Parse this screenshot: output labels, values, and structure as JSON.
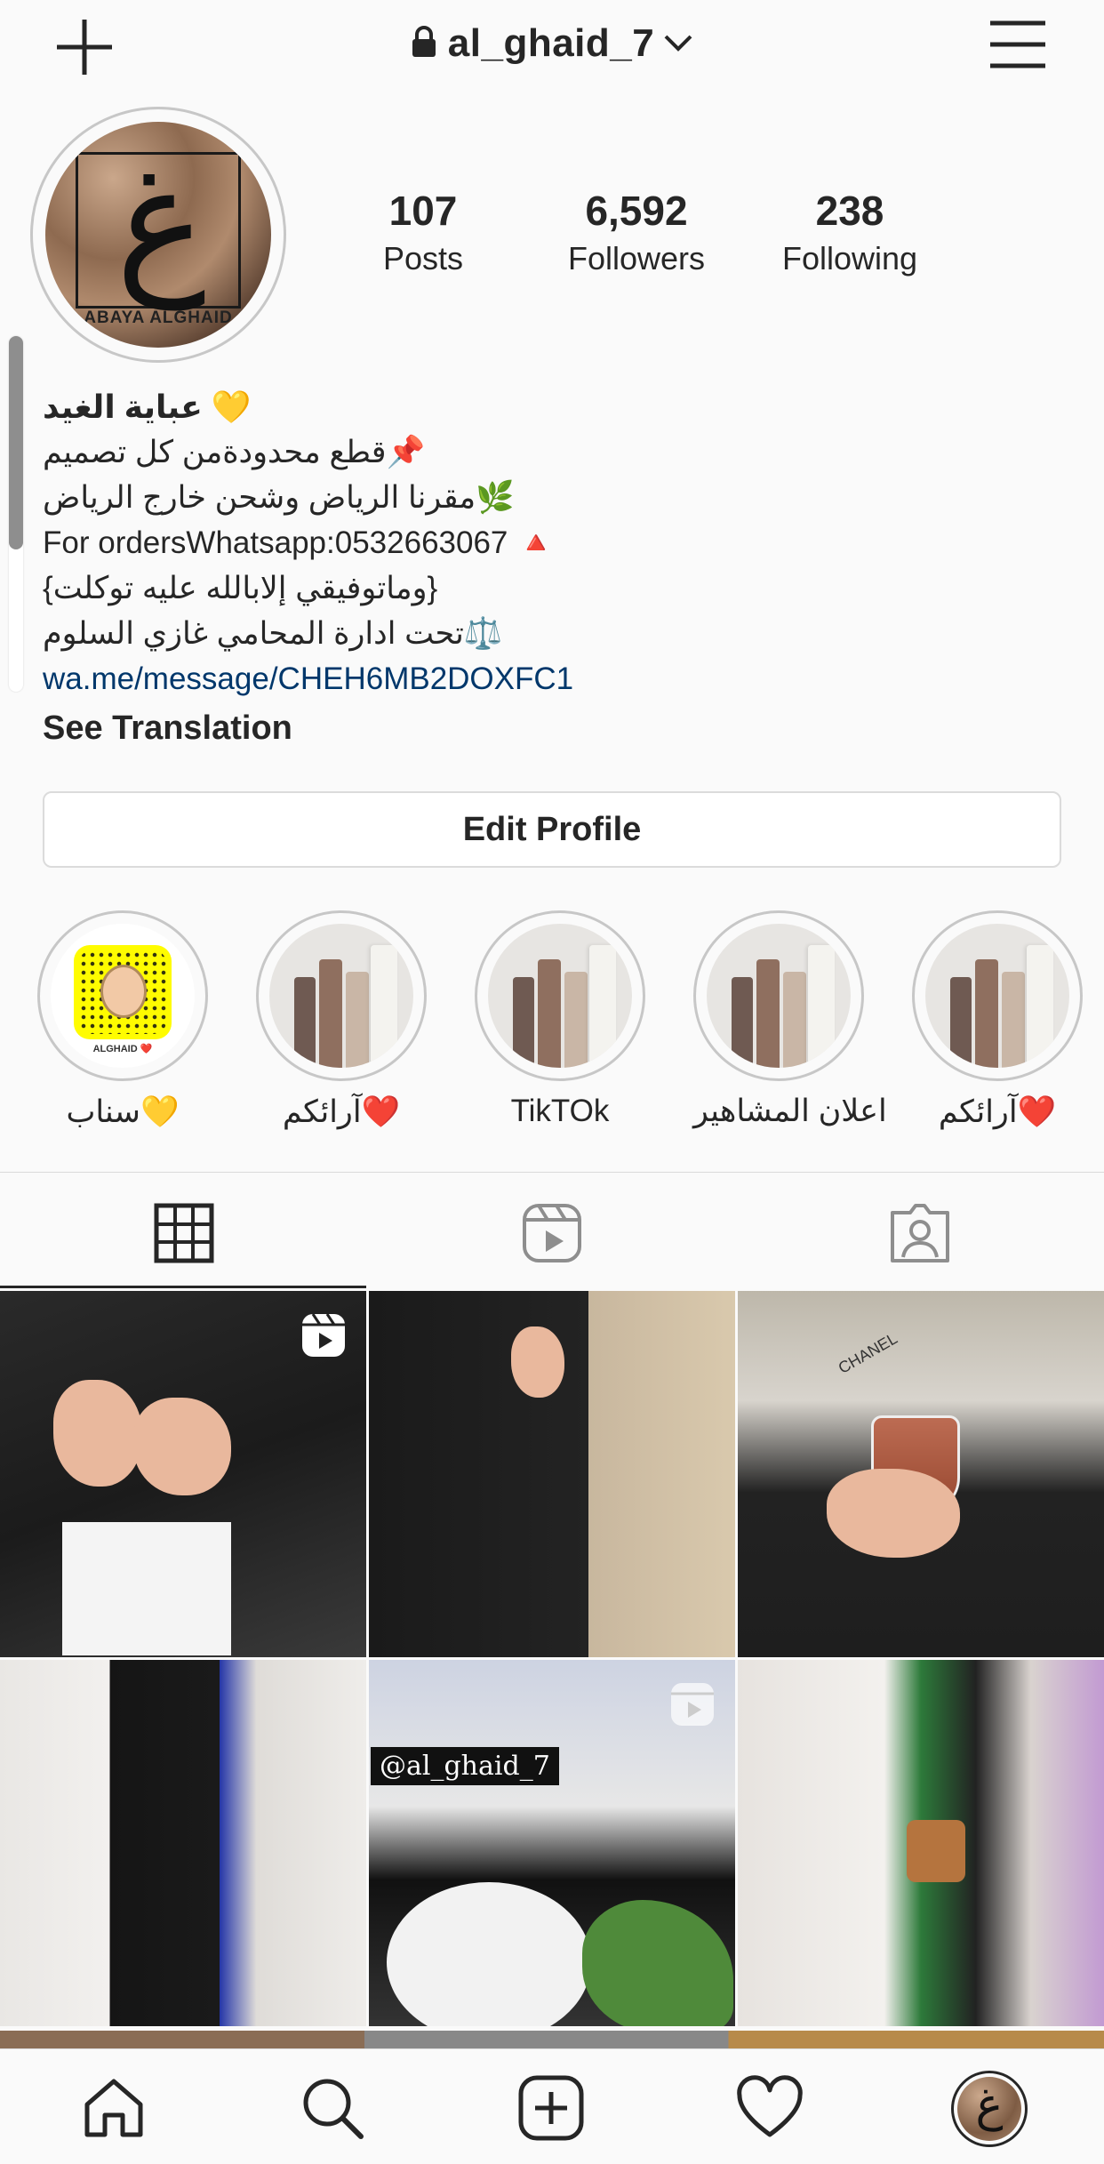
{
  "header": {
    "username": "al_ghaid_7",
    "icons": [
      "plus-icon",
      "lock-icon",
      "chevron-down-icon",
      "menu-icon"
    ]
  },
  "avatar": {
    "glyph": "غ",
    "brand_text": "ABAYA ALGHAID"
  },
  "stats": [
    {
      "value": "107",
      "label": "Posts"
    },
    {
      "value": "6,592",
      "label": "Followers"
    },
    {
      "value": "238",
      "label": "Following"
    }
  ],
  "bio": {
    "name": "عباية الغيد 💛",
    "lines": [
      "قطع محدودةمن كل تصميم📌",
      "مقرنا الرياض وشحن خارج الرياض🌿",
      "For ordersWhatsapp:0532663067 🔺",
      "{وماتوفيقي إلابالله عليه توكلت}",
      "تحت ادارة المحامي غازي السلوم⚖️"
    ],
    "link": "wa.me/message/CHEH6MB2DOXFC1",
    "see_translation": "See Translation"
  },
  "edit_profile_label": "Edit Profile",
  "highlights": [
    {
      "label": "سناب💛",
      "type": "snapcode",
      "snap_label": "ALGHAID ❤️"
    },
    {
      "label": "آرائكم❤️",
      "type": "fabric"
    },
    {
      "label": "TikTOk",
      "type": "fabric"
    },
    {
      "label": "اعلان المشاهير",
      "type": "fabric"
    },
    {
      "label": "آرائكم❤️",
      "type": "fabric"
    }
  ],
  "tabs": [
    "grid-icon",
    "reels-icon",
    "tagged-icon"
  ],
  "posts": [
    {
      "reel": true
    },
    {
      "reel": false
    },
    {
      "reel": false,
      "caption": "CHANEL"
    },
    {
      "reel": false
    },
    {
      "reel": true,
      "overlay_text": "@al_ghaid_7"
    },
    {
      "reel": false
    }
  ],
  "bottom_nav": [
    "home-icon",
    "search-icon",
    "new-post-icon",
    "activity-heart-icon",
    "profile-avatar"
  ]
}
